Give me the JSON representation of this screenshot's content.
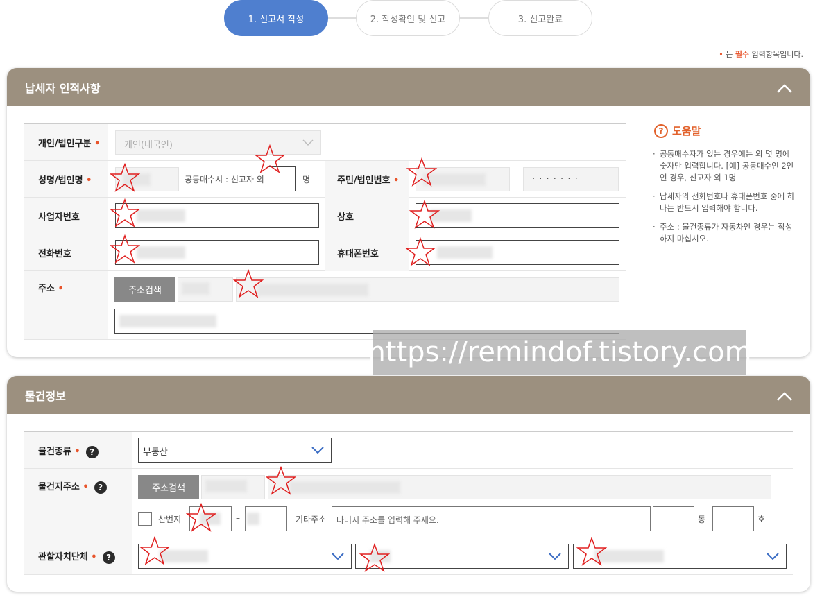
{
  "steps": [
    "1. 신고서 작성",
    "2. 작성확인 및 신고",
    "3. 신고완료"
  ],
  "required_note": {
    "prefix": "는",
    "highlight": "필수",
    "suffix": "입력항목입니다."
  },
  "taxpayer": {
    "title": "납세자 인적사항",
    "type_label": "개인/법인구분",
    "type_value": "개인(내국인)",
    "name_label": "성명/법인명",
    "co_buyer_text": "공동매수시 : 신고자 외",
    "co_buyer_unit": "명",
    "id_label": "주민/법인번호",
    "id_dash": "–",
    "id_masked": "· · · · · · ·",
    "biz_no_label": "사업자번호",
    "trade_name_label": "상호",
    "phone_label": "전화번호",
    "mobile_label": "휴대폰번호",
    "address_label": "주소",
    "address_search": "주소검색"
  },
  "help": {
    "title": "도움말",
    "items": [
      "공동매수자가 있는 경우에는 외 몇 명에 숫자만 입력합니다. [예] 공동매수인 2인인 경우, 신고자 외 1명",
      "납세자의 전화번호나 휴대폰번호 중에 하나는 반드시 입력해야 합니다.",
      "주소 : 물건종류가 자동차인 경우는 작성하지 마십시오."
    ]
  },
  "property": {
    "title": "물건정보",
    "type_label": "물건종류",
    "type_value": "부동산",
    "address_label": "물건지주소",
    "address_search": "주소검색",
    "mountain_label": "산번지",
    "dash": "–",
    "etc_label": "기타주소",
    "etc_placeholder": "나머지 주소를 입력해 주세요.",
    "dong_unit": "동",
    "ho_unit": "호",
    "authority_label": "관할자치단체"
  },
  "watermark": "https://remindof.tistory.com",
  "colors": {
    "accent": "#4f7fcf",
    "header": "#9c907f",
    "required": "#e8542b",
    "help": "#e2622c"
  }
}
